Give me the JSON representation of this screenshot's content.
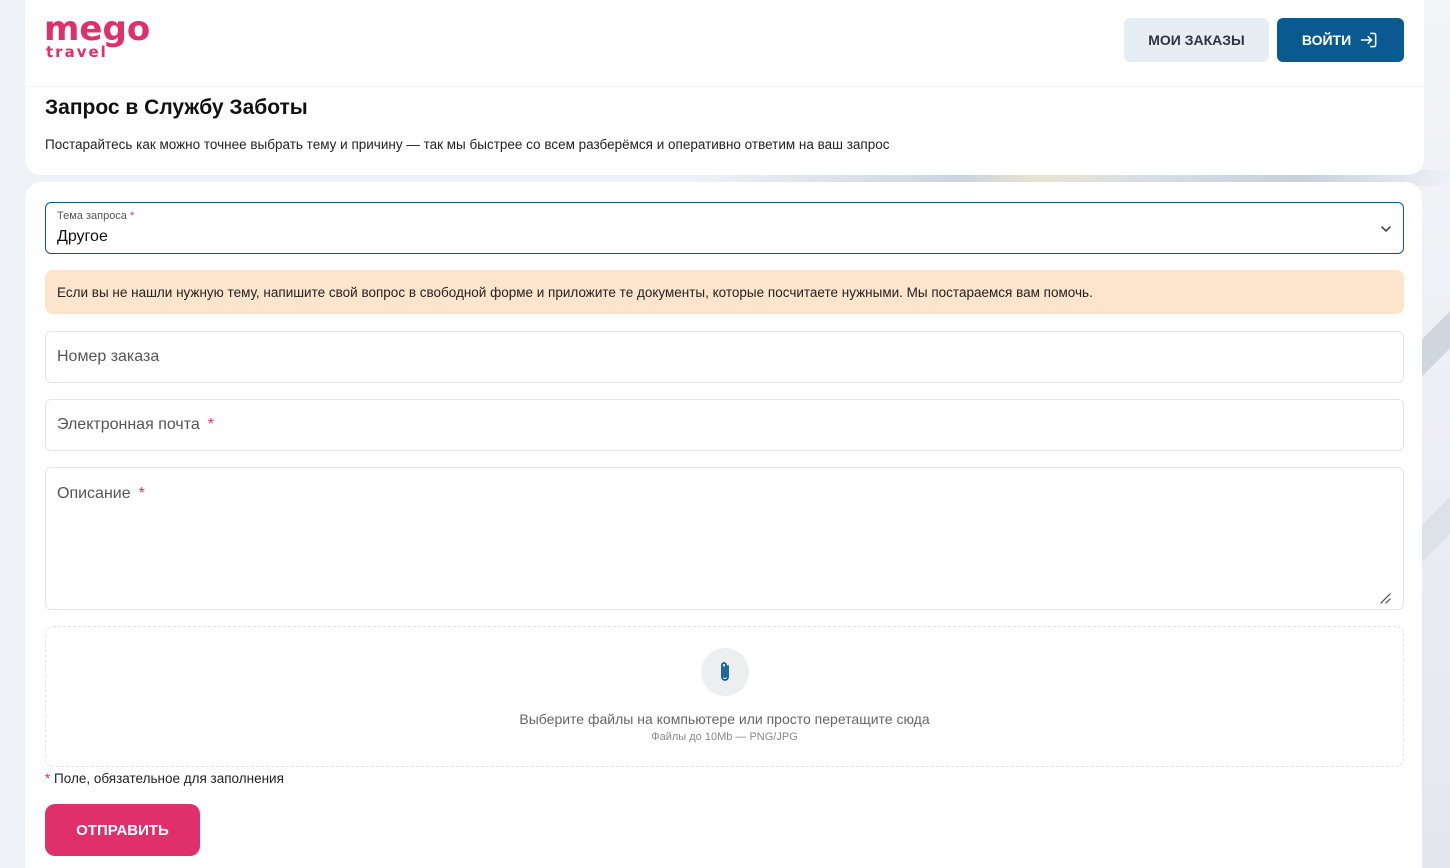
{
  "brand": {
    "logo_main": "mego",
    "logo_sub": "travel",
    "accent_color": "#e0306b",
    "primary_color": "#0a5a92"
  },
  "header": {
    "my_orders_label": "МОИ ЗАКАЗЫ",
    "login_label": "ВОЙТИ",
    "login_icon": "login-icon"
  },
  "page": {
    "title": "Запрос в Службу Заботы",
    "subtitle": "Постарайтесь как можно точнее выбрать тему и причину — так мы быстрее со всем разберёмся и оперативно ответим на ваш запрос"
  },
  "form": {
    "topic": {
      "label": "Тема запроса",
      "required_mark": "*",
      "value": "Другое",
      "icon": "chevron-down-icon"
    },
    "notice": "Если вы не нашли нужную тему, напишите свой вопрос в свободной форме и приложите те документы, которые посчитаете нужными. Мы постараемся вам помочь.",
    "order_number": {
      "placeholder": "Номер заказа"
    },
    "email": {
      "placeholder": "Электронная почта",
      "required_mark": "*"
    },
    "description": {
      "placeholder": "Описание",
      "required_mark": "*"
    },
    "upload": {
      "icon": "paperclip-icon",
      "main_text": "Выберите файлы на компьютере или просто перетащите сюда",
      "sub_text": "Файлы до 10Mb — PNG/JPG"
    },
    "required_note_mark": "*",
    "required_note": "Поле, обязательное для заполнения",
    "submit_label": "ОТПРАВИТЬ"
  }
}
